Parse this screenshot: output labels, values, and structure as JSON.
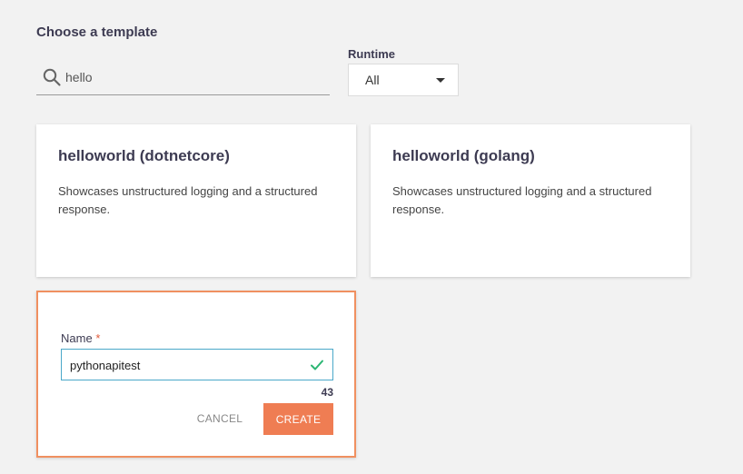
{
  "heading": "Choose a template",
  "search": {
    "value": "hello",
    "icon": "search-icon"
  },
  "runtime": {
    "label": "Runtime",
    "selected": "All"
  },
  "templates": [
    {
      "title": "helloworld (dotnetcore)",
      "description": "Showcases unstructured logging and a structured response."
    },
    {
      "title": "helloworld (golang)",
      "description": "Showcases unstructured logging and a structured response."
    }
  ],
  "create_form": {
    "name_label": "Name",
    "required_marker": "*",
    "name_value": "pythonapitest",
    "char_counter": "43",
    "cancel_label": "CANCEL",
    "create_label": "CREATE"
  },
  "colors": {
    "accent": "#ef7d53",
    "input_focus": "#4aa8c9",
    "valid_check": "#2bb673"
  }
}
